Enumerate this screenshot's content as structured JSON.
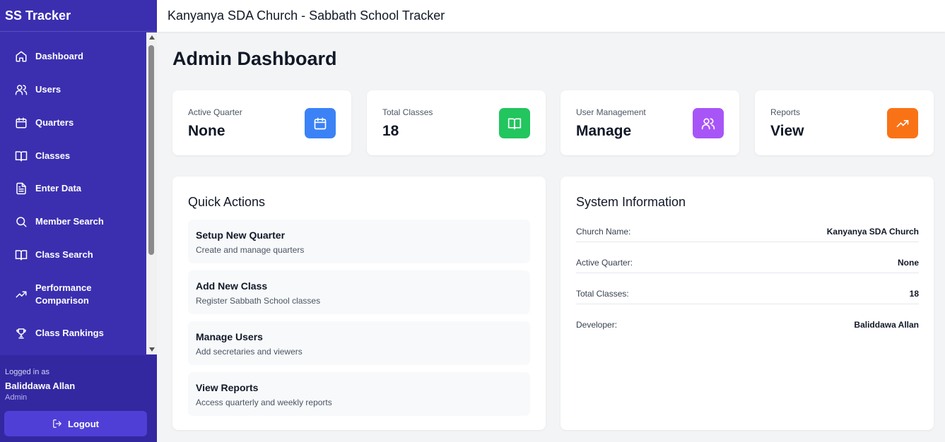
{
  "app": {
    "brand": "SS Tracker",
    "header_title": "Kanyanya SDA Church - Sabbath School Tracker"
  },
  "sidebar": {
    "items": [
      {
        "label": "Dashboard",
        "icon": "home-icon"
      },
      {
        "label": "Users",
        "icon": "users-icon"
      },
      {
        "label": "Quarters",
        "icon": "calendar-icon"
      },
      {
        "label": "Classes",
        "icon": "book-icon"
      },
      {
        "label": "Enter Data",
        "icon": "file-text-icon"
      },
      {
        "label": "Member Search",
        "icon": "search-icon"
      },
      {
        "label": "Class Search",
        "icon": "book-icon"
      },
      {
        "label": "Performance Comparison",
        "icon": "trending-up-icon"
      },
      {
        "label": "Class Rankings",
        "icon": "trophy-icon"
      }
    ],
    "user": {
      "logged_in_label": "Logged in as",
      "name": "Baliddawa Allan",
      "role": "Admin"
    },
    "logout_label": "Logout"
  },
  "main": {
    "title": "Admin Dashboard",
    "stats": [
      {
        "label": "Active Quarter",
        "value": "None",
        "icon": "calendar-icon",
        "color": "#3b82f6"
      },
      {
        "label": "Total Classes",
        "value": "18",
        "icon": "book-icon",
        "color": "#22c55e"
      },
      {
        "label": "User Management",
        "value": "Manage",
        "icon": "users-icon",
        "color": "#a855f7"
      },
      {
        "label": "Reports",
        "value": "View",
        "icon": "trending-up-icon",
        "color": "#f97316"
      }
    ],
    "quick_actions": {
      "title": "Quick Actions",
      "items": [
        {
          "title": "Setup New Quarter",
          "desc": "Create and manage quarters"
        },
        {
          "title": "Add New Class",
          "desc": "Register Sabbath School classes"
        },
        {
          "title": "Manage Users",
          "desc": "Add secretaries and viewers"
        },
        {
          "title": "View Reports",
          "desc": "Access quarterly and weekly reports"
        }
      ]
    },
    "system_info": {
      "title": "System Information",
      "rows": [
        {
          "key": "Church Name:",
          "value": "Kanyanya SDA Church"
        },
        {
          "key": "Active Quarter:",
          "value": "None"
        },
        {
          "key": "Total Classes:",
          "value": "18"
        },
        {
          "key": "Developer:",
          "value": "Baliddawa Allan"
        }
      ]
    }
  }
}
